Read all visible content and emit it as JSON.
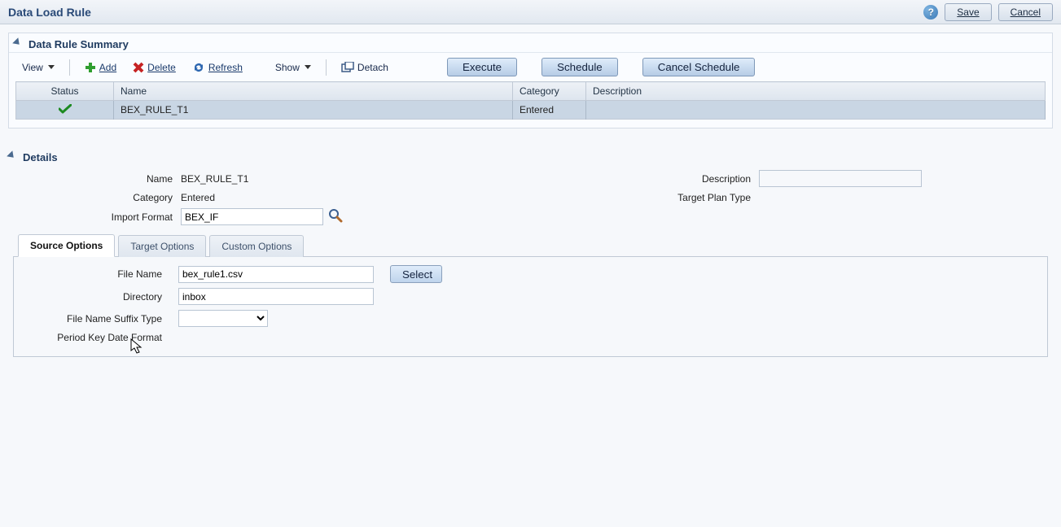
{
  "header": {
    "title": "Data Load Rule",
    "save": "Save",
    "cancel": "Cancel"
  },
  "summary": {
    "title": "Data Rule Summary",
    "toolbar": {
      "view": "View",
      "add": "Add",
      "delete": "Delete",
      "refresh": "Refresh",
      "show": "Show",
      "detach": "Detach",
      "execute": "Execute",
      "schedule": "Schedule",
      "cancel_schedule": "Cancel Schedule"
    },
    "columns": {
      "status": "Status",
      "name": "Name",
      "category": "Category",
      "description": "Description"
    },
    "rows": [
      {
        "status_ok": true,
        "name": "BEX_RULE_T1",
        "category": "Entered",
        "description": ""
      }
    ]
  },
  "details": {
    "title": "Details",
    "labels": {
      "name": "Name",
      "category": "Category",
      "import_format": "Import Format",
      "description": "Description",
      "target_plan_type": "Target Plan Type"
    },
    "values": {
      "name": "BEX_RULE_T1",
      "category": "Entered",
      "import_format": "BEX_IF",
      "description": "",
      "target_plan_type": ""
    },
    "tabs": {
      "source": "Source Options",
      "target": "Target Options",
      "custom": "Custom Options"
    },
    "source": {
      "labels": {
        "file_name": "File Name",
        "directory": "Directory",
        "suffix": "File Name Suffix Type",
        "period_key": "Period Key Date Format"
      },
      "values": {
        "file_name": "bex_rule1.csv",
        "directory": "inbox",
        "suffix": ""
      },
      "select_btn": "Select"
    }
  }
}
